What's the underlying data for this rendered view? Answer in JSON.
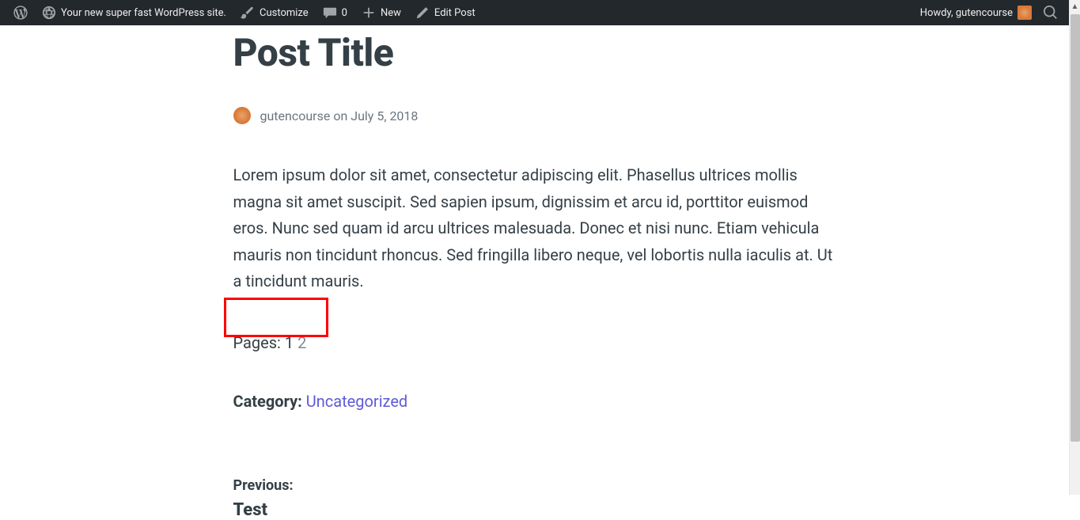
{
  "adminbar": {
    "site_name": "Your new super fast WordPress site.",
    "customize": "Customize",
    "comments_count": "0",
    "new": "New",
    "edit_post": "Edit Post",
    "howdy_prefix": "Howdy, ",
    "username": "gutencourse"
  },
  "post": {
    "title": "Post Title",
    "author": "gutencourse",
    "date_joiner": " on ",
    "date": "July 5, 2018",
    "body": "Lorem ipsum dolor sit amet, consectetur adipiscing elit. Phasellus ultrices mollis magna sit amet suscipit. Sed sapien ipsum, dignissim et arcu id, porttitor euismod eros. Nunc sed quam id arcu ultrices malesuada. Donec et nisi nunc. Etiam vehicula mauris non tincidunt rhoncus. Sed fringilla libero neque, vel lobortis nulla iaculis at. Ut a tincidunt mauris.",
    "pages_label": "Pages:",
    "pages_current": "1",
    "pages_other": "2",
    "category_label": "Category:",
    "category_value": "Uncategorized"
  },
  "nav": {
    "prev_label": "Previous:",
    "prev_title": "Test"
  }
}
